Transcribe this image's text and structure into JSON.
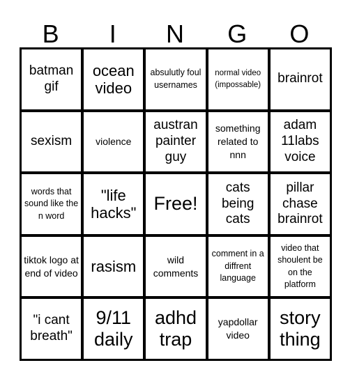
{
  "header": {
    "letters": [
      "B",
      "I",
      "N",
      "G",
      "O"
    ]
  },
  "card": {
    "rows": [
      [
        {
          "text": "batman gif",
          "size": "md"
        },
        {
          "text": "ocean video",
          "size": "lg"
        },
        {
          "text": "absulutly foul usernames",
          "size": "xs"
        },
        {
          "text": "normal video (impossable)",
          "size": "xxs"
        },
        {
          "text": "brainrot",
          "size": "md"
        }
      ],
      [
        {
          "text": "sexism",
          "size": "md"
        },
        {
          "text": "violence",
          "size": "sm"
        },
        {
          "text": "austran painter guy",
          "size": "md"
        },
        {
          "text": "something related to nnn",
          "size": "sm"
        },
        {
          "text": "adam 11labs voice",
          "size": "md"
        }
      ],
      [
        {
          "text": "words that sound like the n word",
          "size": "xs"
        },
        {
          "text": "\"life hacks\"",
          "size": "lg"
        },
        {
          "text": "Free!",
          "size": "xl"
        },
        {
          "text": "cats being cats",
          "size": "md"
        },
        {
          "text": "pillar chase brainrot",
          "size": "md"
        }
      ],
      [
        {
          "text": "tiktok logo at end of video",
          "size": "sm"
        },
        {
          "text": "rasism",
          "size": "lg"
        },
        {
          "text": "wild comments",
          "size": "sm"
        },
        {
          "text": "comment in a diffrent language",
          "size": "xs"
        },
        {
          "text": "video that shoulent be on the platform",
          "size": "xs"
        }
      ],
      [
        {
          "text": "\"i cant breath\"",
          "size": "md"
        },
        {
          "text": "9/11 daily",
          "size": "xl"
        },
        {
          "text": "adhd trap",
          "size": "xl"
        },
        {
          "text": "yapdollar video",
          "size": "sm"
        },
        {
          "text": "story thing",
          "size": "xl"
        }
      ]
    ]
  }
}
